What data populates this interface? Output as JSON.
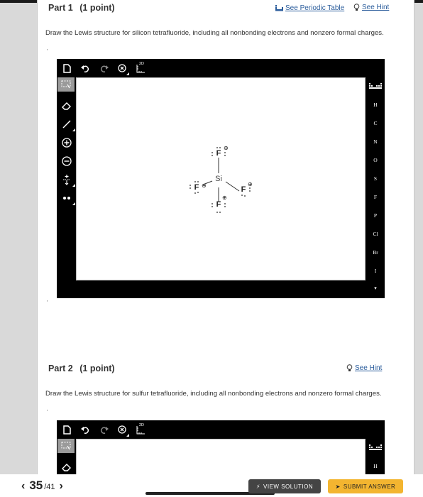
{
  "part1": {
    "title": "Part 1",
    "points": "(1 point)",
    "periodic_table_link": "See Periodic Table",
    "hint_link": "See Hint",
    "prompt": "Draw the Lewis structure for silicon tetrafluoride, including all nonbonding electrons and nonzero formal charges."
  },
  "part2": {
    "title": "Part 2",
    "points": "(1 point)",
    "hint_link": "See Hint",
    "prompt": "Draw the Lewis structure for sulfur tetrafluoride, including all nonbonding electrons and nonzero formal charges."
  },
  "editor": {
    "toolbar_icons": [
      "new-document-icon",
      "undo-icon",
      "redo-icon",
      "zoom-clear-icon",
      "ruler-2d-icon"
    ],
    "ruler_label": "2D",
    "left_tools": [
      "select-lasso-icon",
      "eraser-icon",
      "single-bond-icon",
      "positive-charge-icon",
      "negative-charge-icon",
      "increase-charge-icon",
      "lone-pair-icon"
    ],
    "elements": [
      "H",
      "C",
      "N",
      "O",
      "S",
      "F",
      "P",
      "Cl",
      "Br",
      "I"
    ]
  },
  "molecule": {
    "center": "Si",
    "ligands": [
      "F",
      "F",
      "F",
      "F"
    ],
    "charge_symbol": "⊕"
  },
  "footer": {
    "current_page": "35",
    "total_pages": "/41",
    "view_solution": "VIEW SOLUTION",
    "submit_answer": "SUBMIT ANSWER"
  }
}
